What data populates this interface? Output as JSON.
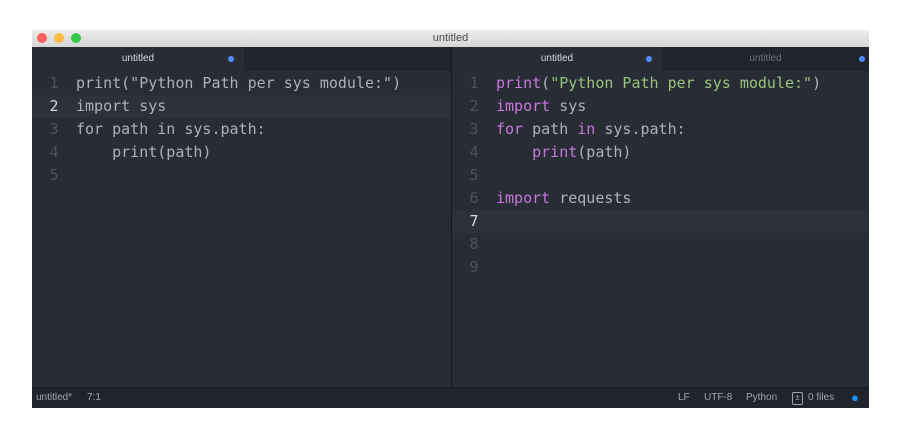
{
  "window": {
    "title": "untitled"
  },
  "left_pane": {
    "tabs": [
      {
        "label": "untitled",
        "modified": true
      }
    ],
    "lines": [
      "print(\"Python Path per sys module:\")",
      "import sys",
      "for path in sys.path:",
      "    print(path)",
      ""
    ],
    "current_line": 2
  },
  "right_pane": {
    "tabs": [
      {
        "label": "untitled",
        "modified": true
      },
      {
        "label": "untitled",
        "modified": true
      }
    ],
    "line_numbers": [
      "1",
      "2",
      "3",
      "4",
      "5",
      "6",
      "7",
      "8",
      "9"
    ],
    "current_line": 7,
    "tokens": {
      "l1": {
        "fn": "print",
        "p1": "(",
        "str": "\"Python Path per sys module:\"",
        "p2": ")"
      },
      "l2": {
        "kw": "import",
        "rest": " sys"
      },
      "l3": {
        "kw1": "for",
        "a": " path ",
        "kw2": "in",
        "b": " sys.path:"
      },
      "l4": {
        "indent": "    ",
        "fn": "print",
        "rest": "(path)"
      },
      "l6": {
        "kw": "import",
        "rest": " requests"
      }
    }
  },
  "status_bar": {
    "file": "untitled*",
    "position": "7:1",
    "line_ending": "LF",
    "encoding": "UTF-8",
    "grammar": "Python",
    "files": "0 files"
  },
  "colors": {
    "background": "#282c34",
    "keyword": "#c678dd",
    "string": "#98c379",
    "accent": "#528bff"
  }
}
